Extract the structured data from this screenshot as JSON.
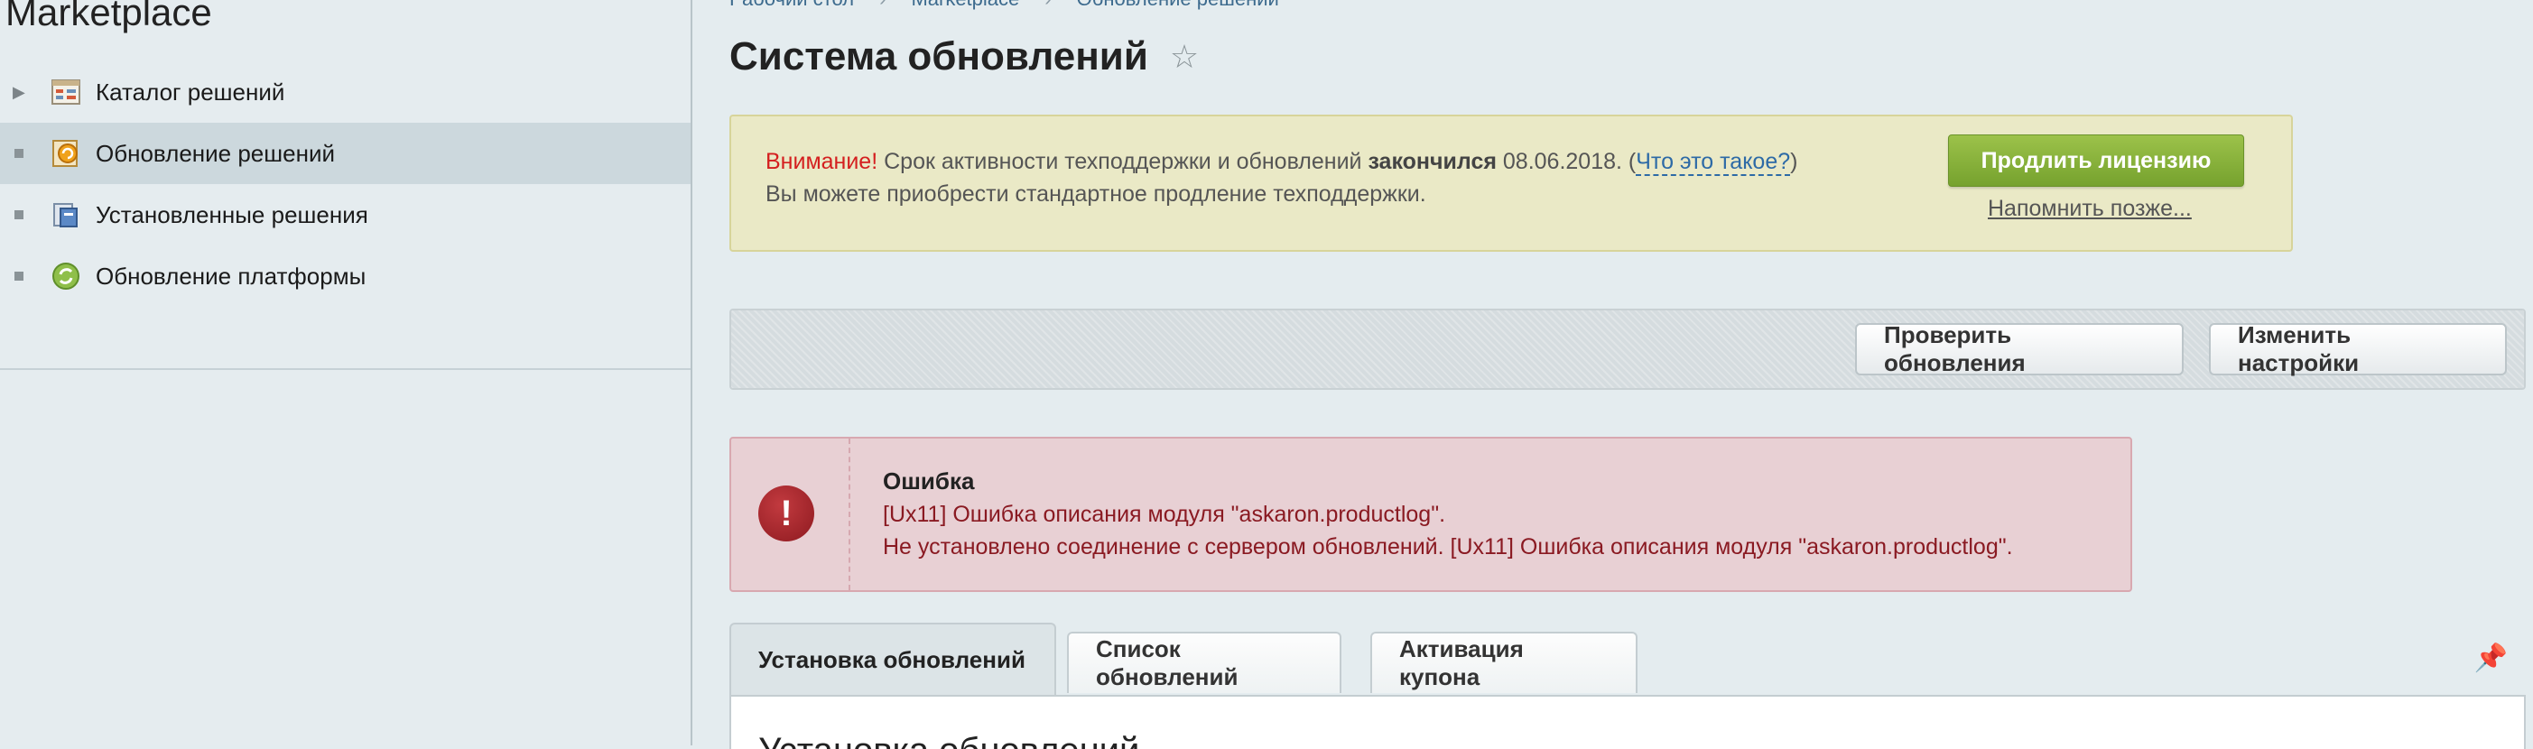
{
  "sidebar": {
    "title": "Marketplace",
    "items": [
      {
        "label": "Каталог решений",
        "icon": "catalog-icon",
        "active": false
      },
      {
        "label": "Обновление решений",
        "icon": "update-solutions-icon",
        "active": true
      },
      {
        "label": "Установленные решения",
        "icon": "installed-icon",
        "active": false
      },
      {
        "label": "Обновление платформы",
        "icon": "platform-update-icon",
        "active": false
      }
    ]
  },
  "breadcrumb": {
    "items": [
      "Рабочий стол",
      "Marketplace",
      "Обновление решений"
    ],
    "separator": "›"
  },
  "page": {
    "title": "Система обновлений"
  },
  "warning": {
    "attention": "Внимание!",
    "text_before": " Срок активности техподдержки и обновлений ",
    "bold": "закончился",
    "text_date": " 08.06.2018. (",
    "link": "Что это такое?",
    "text_close": ")",
    "line2": "Вы можете приобрести стандартное продление техподдержки.",
    "renew_button": "Продлить лицензию",
    "remind_link": "Напомнить позже..."
  },
  "toolbar": {
    "check_label": "Проверить обновления",
    "settings_label": "Изменить настройки"
  },
  "error": {
    "title": "Ошибка",
    "line1": "[Ux11] Ошибка описания модуля \"askaron.productlog\".",
    "line2": "Не установлено соединение с сервером обновлений. [Ux11] Ошибка описания модуля \"askaron.productlog\"."
  },
  "tabs": [
    {
      "label": "Установка обновлений",
      "active": true
    },
    {
      "label": "Список обновлений",
      "active": false
    },
    {
      "label": "Активация купона",
      "active": false
    }
  ],
  "content": {
    "peek": "Установка обновлений"
  },
  "colors": {
    "accent_green": "#76a22e",
    "warning_red": "#d41f1f",
    "error_text": "#8a1a22",
    "link_blue": "#2d6aa6"
  }
}
